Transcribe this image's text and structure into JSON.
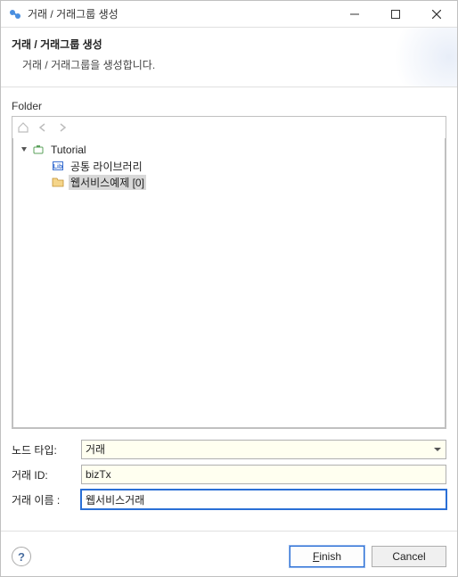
{
  "window": {
    "title": "거래 / 거래그룹 생성"
  },
  "header": {
    "title": "거래 / 거래그룹 생성",
    "description": "거래 / 거래그룹을 생성합니다."
  },
  "folder": {
    "label": "Folder",
    "tree": {
      "root": {
        "label": "Tutorial",
        "children": [
          {
            "label": "공통 라이브러리"
          },
          {
            "label": "웹서비스예제 [0]"
          }
        ]
      }
    }
  },
  "form": {
    "nodeType": {
      "label": "노드 타입:",
      "value": "거래"
    },
    "txId": {
      "label": "거래 ID:",
      "value": "bizTx"
    },
    "txName": {
      "label": "거래 이름  :",
      "value": "웹서비스거래"
    }
  },
  "buttons": {
    "help": "?",
    "finish": "Finish",
    "finish_mn": "F",
    "finish_rest": "inish",
    "cancel": "Cancel"
  }
}
